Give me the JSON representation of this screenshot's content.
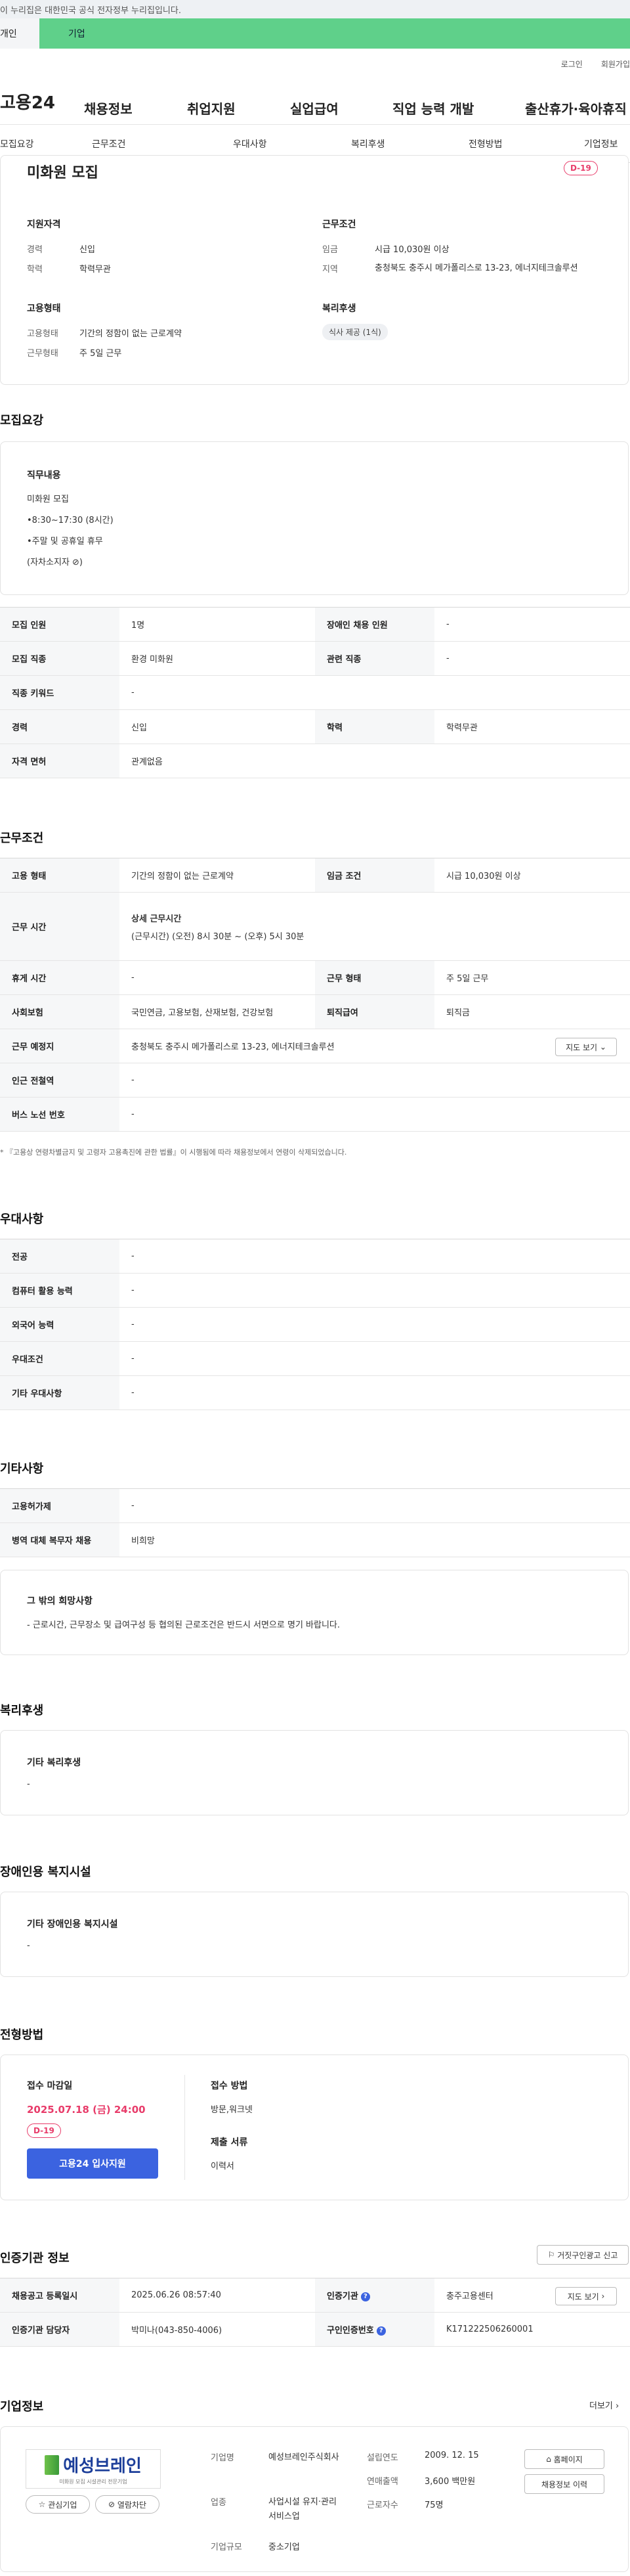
{
  "gov_banner": "이 누리집은 대한민국 공식 전자정부 누리집입니다.",
  "top_tabs": [
    "개인",
    "기업"
  ],
  "util": {
    "login": "로그인",
    "join": "회원가입"
  },
  "gnb": {
    "logo": "고용24",
    "items": [
      "채용정보",
      "취업지원",
      "실업급여",
      "직업 능력 개발",
      "출산휴가·육아휴직"
    ]
  },
  "subnav": [
    "모집요강",
    "근무조건",
    "우대사항",
    "복리후생",
    "전형방법",
    "기업정보"
  ],
  "summary": {
    "title": "미화원 모집",
    "dday": "D-19",
    "qual_title": "지원자격",
    "career_label": "경력",
    "career": "신입",
    "edu_label": "학력",
    "edu": "학력무관",
    "work_title": "근무조건",
    "wage_label": "임금",
    "wage": "시급 10,030원 이상",
    "region_label": "지역",
    "region": "충청북도 충주시 메가폴리스로 13-23, 에너지테크솔루션",
    "emp_title": "고용형태",
    "emp_label": "고용형태",
    "emp": "기간의 정함이 없는 근로계약",
    "worktype_label": "근무형태",
    "worktype": "주 5일 근무",
    "welfare_title": "복리후생",
    "welfare_chip": "식사 제공 (1식)"
  },
  "recruit": {
    "heading": "모집요강",
    "duty_title": "직무내용",
    "duty_lines": [
      "미화원 모집",
      "•8:30~17:30 (8시간)",
      "•주말 및 공휴일 휴무",
      "(자차소지자 ⊘)"
    ],
    "rows": [
      [
        "모집 인원",
        "1명",
        "장애인 채용 인원",
        "-"
      ],
      [
        "모집 직종",
        "환경 미화원",
        "관련 직종",
        "-"
      ],
      [
        "직종 키워드",
        "-",
        "",
        ""
      ],
      [
        "경력",
        "신입",
        "학력",
        "학력무관"
      ],
      [
        "자격 면허",
        "관계없음",
        "",
        ""
      ]
    ]
  },
  "conditions": {
    "heading": "근무조건",
    "emp_type_label": "고용 형태",
    "emp_type": "기간의 정함이 없는 근로계약",
    "wage_label": "임금 조건",
    "wage": "시급 10,030원 이상",
    "hours_label": "근무 시간",
    "hours_title": "상세 근무시간",
    "hours": "(근무시간) (오전) 8시 30분 ~ (오후) 5시 30분",
    "break_label": "휴게 시간",
    "break": "-",
    "worktype_label": "근무 형태",
    "worktype": "주 5일 근무",
    "insurance_label": "사회보험",
    "insurance": "국민연금, 고용보험, 산재보험, 건강보험",
    "severance_label": "퇴직급여",
    "severance": "퇴직금",
    "place_label": "근무 예정지",
    "place": "충청북도 충주시 메가폴리스로 13-23, 에너지테크솔루션",
    "map_btn": "지도 보기",
    "station_label": "인근 전철역",
    "station": "-",
    "bus_label": "버스 노선 번호",
    "bus": "-",
    "note": "* 『고용상 연령차별금지 및 고령자 고용촉진에 관한 법률』이 시행됨에 따라 채용정보에서 연령이 삭제되었습니다."
  },
  "preference": {
    "heading": "우대사항",
    "rows": [
      [
        "전공",
        "-"
      ],
      [
        "컴퓨터 활용 능력",
        "-"
      ],
      [
        "외국어 능력",
        "-"
      ],
      [
        "우대조건",
        "-"
      ],
      [
        "기타 우대사항",
        "-"
      ]
    ]
  },
  "etc": {
    "heading": "기타사항",
    "rows": [
      [
        "고용허가제",
        "-"
      ],
      [
        "병역 대체 복무자 채용",
        "비희망"
      ]
    ],
    "wish_title": "그 밖의 희망사항",
    "wish": "- 근로시간, 근무장소 및 급여구성 등 협의된 근로조건은 반드시 서면으로 명기 바랍니다."
  },
  "welfare": {
    "heading": "복리후생",
    "title": "기타 복리후생",
    "value": "-"
  },
  "disabled": {
    "heading": "장애인용 복지시설",
    "title": "기타 장애인용 복지시설",
    "value": "-"
  },
  "selection": {
    "heading": "전형방법",
    "deadline_label": "접수 마감일",
    "deadline": "2025.07.18 (금) 24:00",
    "dday": "D-19",
    "apply_btn": "고용24 입사지원",
    "method_label": "접수 방법",
    "method": "방문,워크넷",
    "docs_label": "제출 서류",
    "docs": "이력서"
  },
  "cert": {
    "heading": "인증기관 정보",
    "report_btn": "거짓구인광고 신고",
    "reg_label": "채용공고 등록일시",
    "reg": "2025.06.26 08:57:40",
    "agency_label": "인증기관",
    "agency": "충주고용센터",
    "map_btn": "지도 보기",
    "manager_label": "인증기관 담당자",
    "manager": "박미나(043-850-4006)",
    "certno_label": "구인인증번호",
    "certno": "K171222506260001"
  },
  "company": {
    "heading": "기업정보",
    "more": "더보기",
    "logo_text": "예성브레인",
    "logo_sub": "미화원 모집 시설관리 전문기업",
    "fav_btn": "관심기업",
    "block_btn": "열람차단",
    "name_label": "기업명",
    "name": "예성브레인주식회사",
    "industry_label": "업종",
    "industry": "사업시설 유지·관리 서비스업",
    "scale_label": "기업규모",
    "scale": "중소기업",
    "founded_label": "설립연도",
    "founded": "2009. 12. 15",
    "sales_label": "연매출액",
    "sales": "3,600 백만원",
    "employees_label": "근로자수",
    "employees": "75명",
    "home_btn": "홈페이지",
    "history_btn": "채용정보 이력"
  },
  "colors": {
    "accent": "#3b63e0",
    "dday": "#e83c6a",
    "topbar": "#5fd08a"
  }
}
